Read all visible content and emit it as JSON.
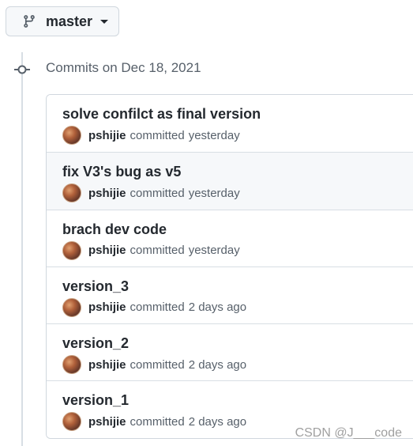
{
  "branch": {
    "name": "master",
    "icon": "git-branch-icon"
  },
  "timeline": {
    "heading": "Commits on Dec 18, 2021",
    "node_icon": "git-commit-icon"
  },
  "commits": [
    {
      "title": "solve confilct as final version",
      "author": "pshijie",
      "action": "committed",
      "time": "yesterday"
    },
    {
      "title": "fix V3's bug as v5",
      "author": "pshijie",
      "action": "committed",
      "time": "yesterday"
    },
    {
      "title": "brach dev code",
      "author": "pshijie",
      "action": "committed",
      "time": "yesterday"
    },
    {
      "title": "version_3",
      "author": "pshijie",
      "action": "committed",
      "time": "2 days ago"
    },
    {
      "title": "version_2",
      "author": "pshijie",
      "action": "committed",
      "time": "2 days ago"
    },
    {
      "title": "version_1",
      "author": "pshijie",
      "action": "committed",
      "time": "2 days ago"
    }
  ],
  "watermark": "CSDN @J___code",
  "colors": {
    "text": "#24292f",
    "muted": "#57606a",
    "border": "#d0d7de",
    "hover_bg": "#f6f8fa"
  }
}
